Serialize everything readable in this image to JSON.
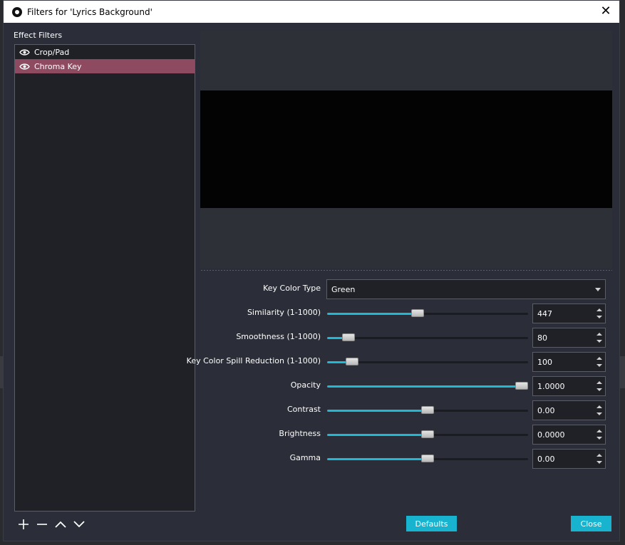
{
  "window": {
    "title": "Filters for 'Lyrics Background'",
    "close_glyph": "✕"
  },
  "filters": {
    "section_label": "Effect Filters",
    "items": [
      {
        "label": "Crop/Pad",
        "selected": false,
        "icon": "eye-icon"
      },
      {
        "label": "Chroma Key",
        "selected": true,
        "icon": "eye-icon"
      }
    ]
  },
  "properties": {
    "key_color_type": {
      "label": "Key Color Type",
      "value": "Green"
    },
    "sliders": [
      {
        "label": "Similarity (1-1000)",
        "value": "447",
        "fraction": 0.447
      },
      {
        "label": "Smoothness (1-1000)",
        "value": "80",
        "fraction": 0.08
      },
      {
        "label": "Key Color Spill Reduction (1-1000)",
        "value": "100",
        "fraction": 0.1
      },
      {
        "label": "Opacity",
        "value": "1.0000",
        "fraction": 1.0
      },
      {
        "label": "Contrast",
        "value": "0.00",
        "fraction": 0.5
      },
      {
        "label": "Brightness",
        "value": "0.0000",
        "fraction": 0.5
      },
      {
        "label": "Gamma",
        "value": "0.00",
        "fraction": 0.5
      }
    ]
  },
  "buttons": {
    "defaults": "Defaults",
    "close": "Close"
  },
  "colors": {
    "accent": "#1fb9d4",
    "selected_item": "#8d4a61"
  }
}
